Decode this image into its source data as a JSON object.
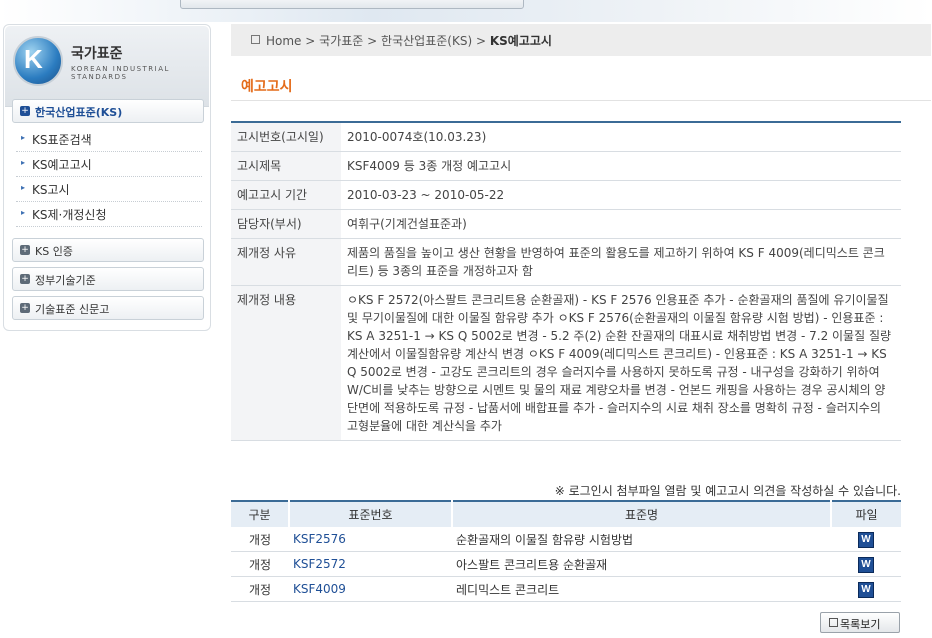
{
  "logo": {
    "title": "국가표준",
    "subtitle": "KOREAN INDUSTRIAL STANDARDS",
    "mark": "K"
  },
  "sidebar": {
    "active_section": "한국산업표준(KS)",
    "sub_items": [
      "KS표준검색",
      "KS예고고시",
      "KS고시",
      "KS제·개정신청"
    ],
    "sections": [
      "KS 인증",
      "정부기술기준",
      "기술표준 신문고"
    ]
  },
  "breadcrumb": {
    "home": "Home",
    "level1": "국가표준",
    "level2": "한국산업표준(KS)",
    "current": "KS예고고시",
    "sep": ">"
  },
  "page_title": "예고고시",
  "info": [
    {
      "label": "고시번호(고시일)",
      "value": "2010-0074호(10.03.23)"
    },
    {
      "label": "고시제목",
      "value": "KSF4009 등 3종 개정 예고고시"
    },
    {
      "label": "예고고시 기간",
      "value": "2010-03-23 ~ 2010-05-22"
    },
    {
      "label": "담당자(부서)",
      "value": "여휘구(기계건설표준과)"
    },
    {
      "label": "제개정 사유",
      "value": "제품의 품질을 높이고 생산 현황을 반영하여 표준의 활용도를 제고하기 위하여 KS F 4009(레디믹스트 콘크리트) 등 3종의 표준을 개정하고자 함"
    },
    {
      "label": "제개정 내용",
      "value": "ㅇKS F 2572(아스팔트 콘크리트용 순환골재) - KS F 2576 인용표준 추가 - 순환골재의 품질에 유기이물질 및 무기이물질에 대한 이물질 함유량 추가 ㅇKS F 2576(순환골재의 이물질 함유량 시험 방법) - 인용표준 : KS A 3251-1 → KS Q 5002로 변경 - 5.2 주(2) 순환 잔골재의 대표시료 채취방법 변경 - 7.2 이물질 질량계산에서 이물질함유량 계산식 변경 ㅇKS F 4009(레디믹스트 콘크리트) - 인용표준 : KS A 3251-1 → KS Q 5002로 변경 - 고강도 콘크리트의 경우 슬러지수를 사용하지 못하도록 규정 - 내구성을 강화하기 위하여 W/C비를 낮추는 방향으로 시멘트 및 물의 재료 계량오차를 변경 - 언본드 캐핑을 사용하는 경우 공시체의 양단면에 적용하도록 규정 - 납품서에 배합표를 추가 - 슬러지수의 시료 채취 장소를 명확히 규정 - 슬러지수의 고형분율에 대한 계산식을 추가"
    }
  ],
  "notice": "※ 로그인시 첨부파일 열람 및 예고고시 의견을 작성하실 수 있습니다.",
  "files": {
    "headers": [
      "구분",
      "표준번호",
      "표준명",
      "파일"
    ],
    "rows": [
      {
        "type": "개정",
        "code": "KSF2576",
        "name": "순환골재의 이물질 함유량 시험방법",
        "file_icon": "W"
      },
      {
        "type": "개정",
        "code": "KSF2572",
        "name": "아스팔트 콘크리트용 순환골재",
        "file_icon": "W"
      },
      {
        "type": "개정",
        "code": "KSF4009",
        "name": "레디믹스트 콘크리트",
        "file_icon": "W"
      }
    ]
  },
  "list_button": "목록보기",
  "colors": {
    "accent_orange": "#e46b1a",
    "navy": "#1f4f96",
    "table_border": "#3b6b96",
    "header_bg": "#e5edf5"
  }
}
